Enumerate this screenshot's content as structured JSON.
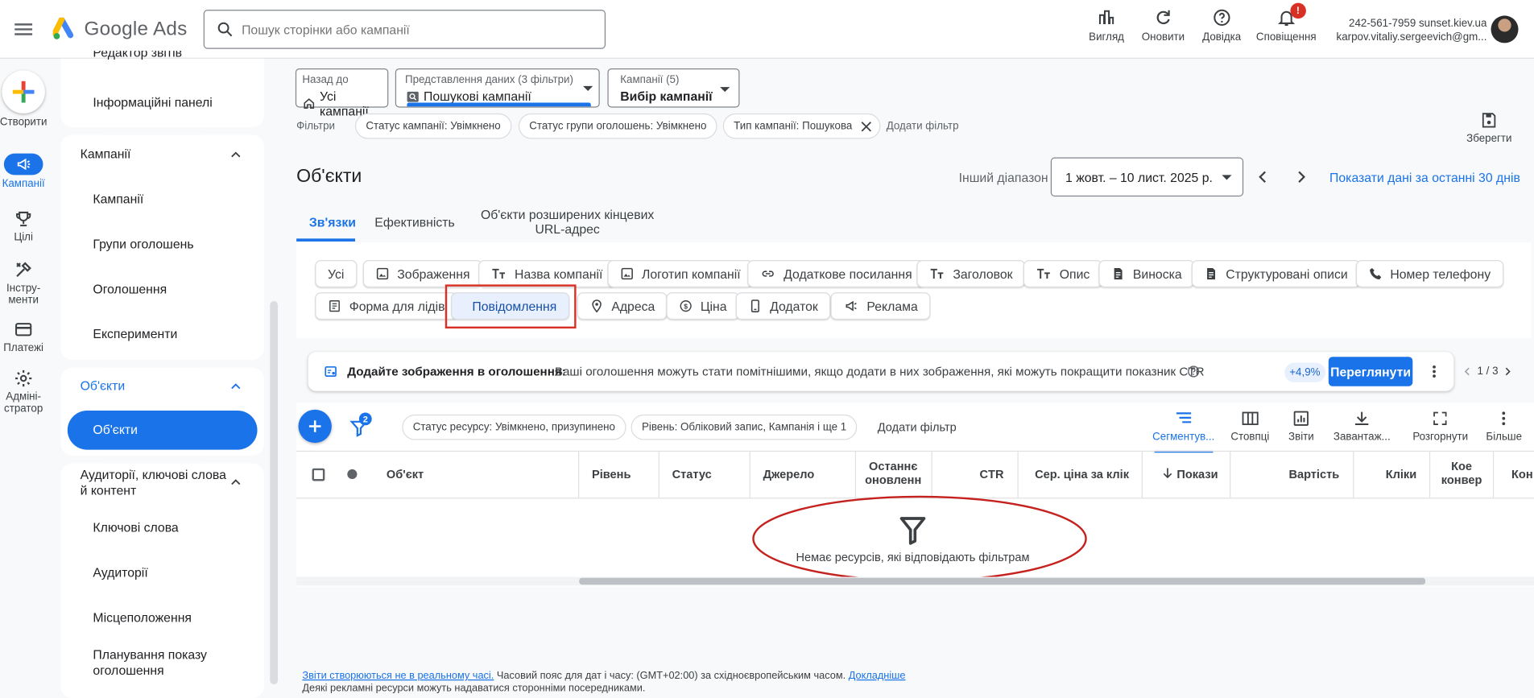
{
  "header": {
    "app_name": "Google Ads",
    "search_placeholder": "Пошук сторінки або кампанії",
    "buttons": {
      "view": "Вигляд",
      "refresh": "Оновити",
      "help": "Довідка",
      "notifications": "Сповіщення"
    },
    "notification_count": "!",
    "account_id": "242-561-7959 sunset.kiev.ua",
    "account_email": "karpov.vitaliy.sergeevich@gm..."
  },
  "rail": {
    "create": "Створити",
    "campaigns": "Кампанії",
    "goals": "Цілі",
    "tools": "Інстру-\nменти",
    "billing": "Платежі",
    "admin": "Адміні-\nстратор"
  },
  "sidebar": {
    "top_cut": "Редактор звітів",
    "dashboards": "Інформаційні панелі",
    "campaigns_head": "Кампанії",
    "campaigns": "Кампанії",
    "ad_groups": "Групи оголошень",
    "ads": "Оголошення",
    "experiments": "Експерименти",
    "assets_head": "Об'єкти",
    "assets": "Об'єкти",
    "audiences_head": "Аудиторії, ключові слова й контент",
    "keywords": "Ключові слова",
    "audiences": "Аудиторії",
    "locations": "Місцеположення",
    "ad_schedule": "Планування показу оголошення"
  },
  "pickers": {
    "back_label": "Назад до",
    "back_value": "Усі кампанії",
    "view_label": "Представлення даних (3 фільтри)",
    "view_value": "Пошукові кампанії",
    "campaigns_label": "Кампанії (5)",
    "campaigns_value": "Вибір кампанії"
  },
  "filters": {
    "label": "Фільтри",
    "chips": [
      "Статус кампанії: Увімкнено",
      "Статус групи оголошень: Увімкнено",
      "Тип кампанії: Пошукова"
    ],
    "add": "Додати фільтр",
    "save": "Зберегти"
  },
  "page": {
    "title": "Об'єкти",
    "range_label": "Інший діапазон",
    "date_range": "1 жовт. – 10 лист. 2025 р.",
    "last30": "Показати дані за останні 30 днів"
  },
  "tabs": {
    "associations": "Зв'язки",
    "performance": "Ефективність",
    "final_url": "Об'єкти розширених кінцевих URL-адрес"
  },
  "asset_types": {
    "all": "Усі",
    "image": "Зображення",
    "business_name": "Назва компанії",
    "logo": "Логотип компанії",
    "sitelink": "Додаткове посилання",
    "headline": "Заголовок",
    "description": "Опис",
    "callout": "Виноска",
    "structured_snippet": "Структуровані описи",
    "call": "Номер телефону",
    "lead_form": "Форма для лідів",
    "message": "Повідомлення",
    "location": "Адреса",
    "price": "Ціна",
    "app": "Додаток",
    "promotion": "Реклама"
  },
  "recommendation": {
    "title": "Додайте зображення в оголошення:",
    "text": "Ваші оголошення можуть стати помітнішими, якщо додати в них зображення, які можуть покращити показник CTR",
    "uplift": "+4,9%",
    "button": "Переглянути",
    "pager": "1 / 3"
  },
  "table_toolbar": {
    "filter_count": "2",
    "chips": [
      "Статус ресурсу: Увімкнено, призупинено",
      "Рівень: Обліковий запис, Кампанія і ще 1"
    ],
    "add_filter": "Додати фільтр",
    "segment": "Сегментув...",
    "columns": "Стовпці",
    "reports": "Звіти",
    "download": "Завантаж...",
    "expand": "Розгорнути",
    "more": "Більше"
  },
  "columns": {
    "asset": "Об'єкт",
    "level": "Рівень",
    "status": "Статус",
    "source": "Джерело",
    "last_updated": "Останнє оновленн",
    "ctr": "CTR",
    "avg_cpc": "Сер. ціна за клік",
    "impressions": "Покази",
    "cost": "Вартість",
    "clicks": "Кліки",
    "conv_rate": "Кое конвер",
    "conv": "Кон"
  },
  "empty_state": "Немає ресурсів, які відповідають фільтрам",
  "footer": {
    "link1": "Звіти створюються не в реальному часі.",
    "text1": " Часовий пояс для дат і часу: (GMT+02:00) за східноєвропейським часом. ",
    "link2": "Докладніше",
    "text2": "Деякі рекламні ресурси можуть надаватися сторонніми посередниками."
  },
  "colors": {
    "accent": "#1a73e8",
    "highlight": "#d93025",
    "annotation": "#c5221f"
  }
}
